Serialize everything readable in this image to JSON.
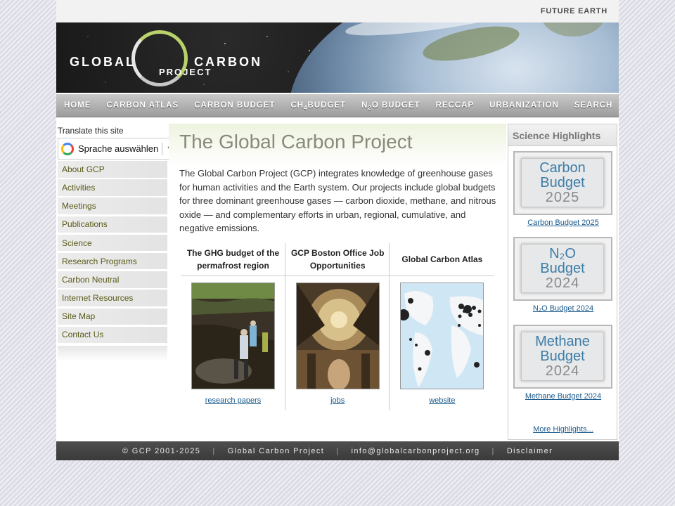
{
  "topbar": {
    "partner": "FUTURE EARTH"
  },
  "logo": {
    "line1": "GLOBAL",
    "line2": "CARBON",
    "line3": "PROJECT"
  },
  "nav": [
    {
      "label": "Home"
    },
    {
      "label": "Carbon Atlas"
    },
    {
      "label": "Carbon Budget"
    },
    {
      "label": "CH",
      "sub": "4",
      "rest": " Budget"
    },
    {
      "label": "N",
      "sub": "2",
      "rest": "O Budget"
    },
    {
      "label": "RECCAP"
    },
    {
      "label": "Urbanization"
    },
    {
      "label": "Search"
    }
  ],
  "translate": {
    "label": "Translate this site",
    "select": "Sprache auswählen",
    "arrow": "▼"
  },
  "sidebar": {
    "items": [
      {
        "label": "About GCP"
      },
      {
        "label": "Activities"
      },
      {
        "label": "Meetings"
      },
      {
        "label": "Publications"
      },
      {
        "label": "Science"
      },
      {
        "label": "Research Programs"
      },
      {
        "label": "Carbon Neutral"
      },
      {
        "label": "Internet Resources"
      },
      {
        "label": "Site Map"
      },
      {
        "label": "Contact Us"
      }
    ]
  },
  "main": {
    "title": "The Global Carbon Project",
    "intro": "The Global Carbon Project (GCP) integrates knowledge of greenhouse gases for human activities and the Earth system. Our projects include global budgets for three dominant greenhouse gases — carbon dioxide, methane, and nitrous oxide — and complementary efforts in urban, regional, cumulative, and negative emissions.",
    "features": [
      {
        "title": "The GHG budget of the permafrost region",
        "link": "research papers"
      },
      {
        "title": "GCP Boston Office Job Opportunities",
        "link": "jobs"
      },
      {
        "title": "Global Carbon Atlas",
        "link": "website"
      }
    ]
  },
  "highlights": {
    "heading": "Science Highlights",
    "items": [
      {
        "line1": "Carbon",
        "line2": "Budget",
        "year": "2025",
        "link": "Carbon Budget 2025"
      },
      {
        "line1": "N₂O",
        "line2": "Budget",
        "year": "2024",
        "link": "N₂O Budget 2024"
      },
      {
        "line1": "Methane",
        "line2": "Budget",
        "year": "2024",
        "link": "Methane Budget 2024"
      }
    ],
    "more": "More Highlights..."
  },
  "footer": {
    "copyright": "© GCP 2001-2025",
    "org": "Global Carbon Project",
    "email": "info@globalcarbonproject.org",
    "disclaimer": "Disclaimer",
    "separator": "|"
  },
  "colors": {
    "accent_orange": "#d98c1a",
    "link_blue": "#1a5a8c",
    "sidebar_text": "#5a5a1a",
    "highlight_blue": "#3d7da8"
  }
}
